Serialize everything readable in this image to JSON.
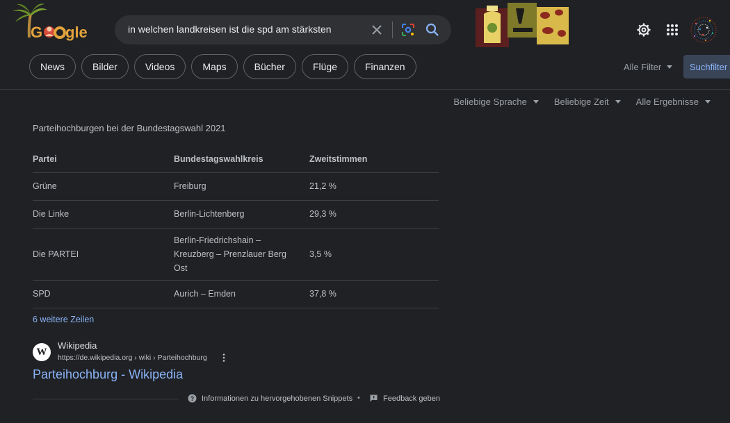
{
  "header": {
    "logo_text": "Google",
    "search": {
      "query": "in welchen landkreisen ist die spd am stärksten",
      "placeholder": ""
    }
  },
  "tabs": [
    {
      "label": "News"
    },
    {
      "label": "Bilder"
    },
    {
      "label": "Videos"
    },
    {
      "label": "Maps"
    },
    {
      "label": "Bücher"
    },
    {
      "label": "Flüge"
    },
    {
      "label": "Finanzen"
    }
  ],
  "filters": {
    "all_filters_label": "Alle Filter",
    "suchfilter_label": "Suchfilter"
  },
  "tools": [
    {
      "label": "Beliebige Sprache"
    },
    {
      "label": "Beliebige Zeit"
    },
    {
      "label": "Alle Ergebnisse"
    }
  ],
  "snippet": {
    "title": "Parteihochburgen bei der Bundestagswahl 2021",
    "table": {
      "headers": [
        "Partei",
        "Bundestagswahlkreis",
        "Zweitstimmen"
      ],
      "rows": [
        [
          "Grüne",
          "Freiburg",
          "21,2 %"
        ],
        [
          "Die Linke",
          "Berlin-Lichtenberg",
          "29,3 %"
        ],
        [
          "Die PARTEI",
          "Berlin-Friedrichshain – Kreuzberg – Prenzlauer Berg Ost",
          "3,5 %"
        ],
        [
          "SPD",
          "Aurich – Emden",
          "37,8 %"
        ]
      ]
    },
    "more_rows_label": "6 weitere Zeilen"
  },
  "source": {
    "favicon_letter": "W",
    "name": "Wikipedia",
    "url": "https://de.wikipedia.org › wiki › Parteihochburg",
    "result_title": "Parteihochburg - Wikipedia"
  },
  "footer": {
    "info_label": "Informationen zu hervorgehobenen Snippets",
    "separator": "•",
    "feedback_label": "Feedback geben"
  },
  "colors": {
    "background": "#202124",
    "link": "#8ab4f8",
    "search_box": "#303134",
    "suchfilter_bg": "#394457"
  },
  "icons": {
    "clear": "close-icon",
    "lens": "google-lens-icon",
    "search": "search-icon",
    "settings": "gear-icon",
    "apps": "apps-grid-icon",
    "more": "kebab-icon",
    "info": "help-circle-icon",
    "feedback": "feedback-icon"
  }
}
